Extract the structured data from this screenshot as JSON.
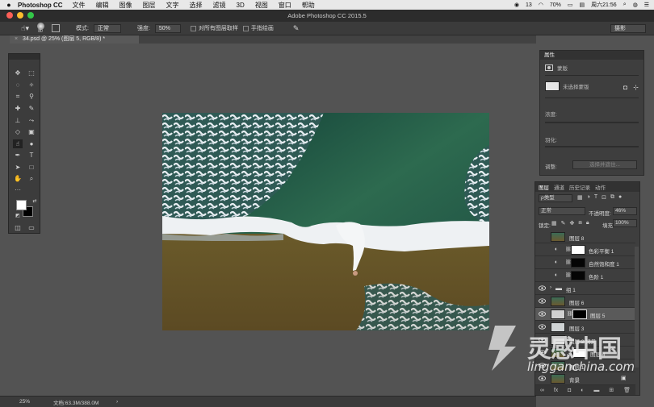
{
  "menubar": {
    "app_name": "Photoshop CC",
    "items": [
      "文件",
      "编辑",
      "图像",
      "图层",
      "文字",
      "选择",
      "滤镜",
      "3D",
      "视图",
      "窗口",
      "帮助"
    ],
    "status_count": "13",
    "battery": "70%",
    "datetime": "周六21:56"
  },
  "window": {
    "title": "Adobe Photoshop CC 2015.5"
  },
  "options": {
    "brush_size": "80",
    "mode_label": "模式:",
    "mode_value": "正常",
    "strength_label": "强度:",
    "strength_value": "50%",
    "sample_all_label": "对所有图层取样",
    "finger_label": "手指绘画",
    "workspace": "摄影"
  },
  "document": {
    "tab_title": "34.psd @ 25% (图层 5, RGB/8) *"
  },
  "status": {
    "zoom": "25%",
    "doc_size": "文档:63.3M/388.0M",
    "arrow": "›"
  },
  "properties": {
    "tab": "属性",
    "mask_label": "蒙版",
    "no_mask": "未选择蒙版",
    "density": "浓度:",
    "feather": "羽化:",
    "adjust": "调整:",
    "select_and_mask": "选择并遮住..."
  },
  "layers": {
    "tabs": [
      "图层",
      "通道",
      "历史记录",
      "动作"
    ],
    "filter_kind": "ρ类型",
    "blend": "正常",
    "opacity_label": "不透明度:",
    "opacity_value": "46%",
    "lock_label": "锁定:",
    "fill_label": "填充:",
    "fill_value": "100%",
    "rows": [
      {
        "name": "图层 8"
      },
      {
        "name": "色彩平衡 1"
      },
      {
        "name": "自然饱和度 1"
      },
      {
        "name": "色阶 1"
      },
      {
        "name": "组 1"
      },
      {
        "name": "图层 6"
      },
      {
        "name": "图层 5"
      },
      {
        "name": "图层 3"
      },
      {
        "name": "图层 2 拷贝"
      },
      {
        "name": "图层 4"
      },
      {
        "name": "图层 1"
      },
      {
        "name": "背景"
      }
    ]
  },
  "watermark": {
    "brand": "灵感中国",
    "url": "lingganchina.com"
  }
}
